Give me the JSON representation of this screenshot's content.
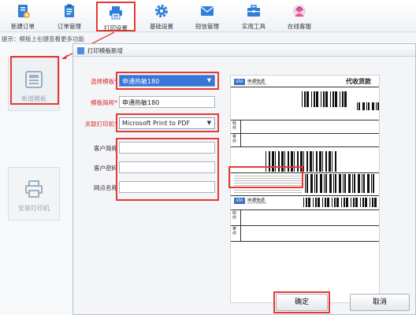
{
  "toolbar": {
    "items": [
      {
        "label": "新建订单",
        "icon": "new-order-icon"
      },
      {
        "label": "订单管理",
        "icon": "clipboard-icon"
      },
      {
        "label": "打印设置",
        "icon": "printer-icon"
      },
      {
        "label": "基础设置",
        "icon": "gear-icon"
      },
      {
        "label": "短信管理",
        "icon": "envelope-icon"
      },
      {
        "label": "实用工具",
        "icon": "toolbox-icon"
      },
      {
        "label": "在线客服",
        "icon": "support-agent-icon"
      }
    ]
  },
  "hint": "提示：模板上右键查看更多功能",
  "left_panel": {
    "new_template_label": "新增模板",
    "install_printer_label": "安装打印机"
  },
  "dialog": {
    "title": "打印模板新增",
    "fields": {
      "template_label": "选择模板*",
      "template_value": "申通热敏180",
      "short_name_label": "模板简称*",
      "short_name_value": "申通热敏180",
      "printer_label": "关联打印机*",
      "printer_value": "Microsoft Print to PDF",
      "customer_name_label": "客户简称",
      "customer_password_label": "客户密码",
      "branch_name_label": "网点名称"
    },
    "preview": {
      "brand_logo": "sto",
      "brand_name": "申通快递",
      "brand_sub": "STO EXPRESS",
      "cod_text": "代收货款",
      "recipient_label": "收件",
      "sender_label": "寄件"
    },
    "ok_label": "确定",
    "cancel_label": "取消"
  },
  "colors": {
    "annotation_red": "#e53935",
    "select_blue": "#3875d7",
    "icon_blue": "#2f7fd8"
  }
}
